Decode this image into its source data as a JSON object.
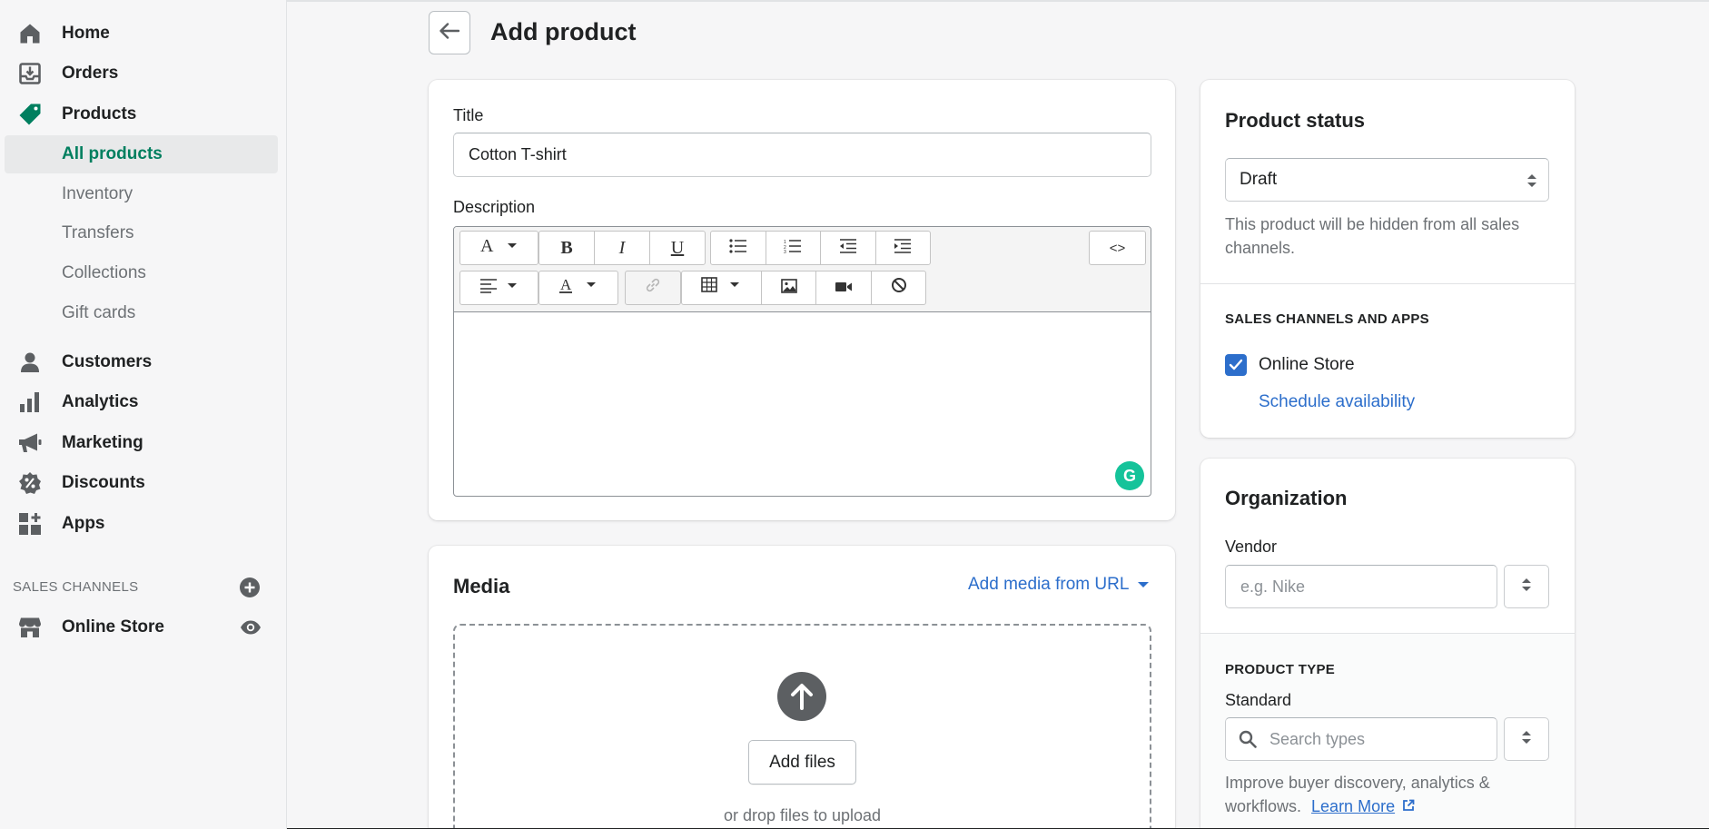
{
  "sidebar": {
    "items": [
      {
        "label": "Home",
        "icon": "home-icon"
      },
      {
        "label": "Orders",
        "icon": "orders-icon"
      },
      {
        "label": "Products",
        "icon": "tag-icon"
      },
      {
        "label": "Customers",
        "icon": "person-icon"
      },
      {
        "label": "Analytics",
        "icon": "bar-chart-icon"
      },
      {
        "label": "Marketing",
        "icon": "megaphone-icon"
      },
      {
        "label": "Discounts",
        "icon": "discount-icon"
      },
      {
        "label": "Apps",
        "icon": "apps-icon"
      }
    ],
    "products_sub": [
      {
        "label": "All products",
        "active": true
      },
      {
        "label": "Inventory"
      },
      {
        "label": "Transfers"
      },
      {
        "label": "Collections"
      },
      {
        "label": "Gift cards"
      }
    ],
    "sales_channels_label": "SALES CHANNELS",
    "sales_channels": [
      {
        "label": "Online Store",
        "icon": "store-icon"
      }
    ]
  },
  "header": {
    "title": "Add product"
  },
  "product_form": {
    "title_label": "Title",
    "title_value": "Cotton T-shirt",
    "description_label": "Description",
    "source_button": "<>"
  },
  "media": {
    "title": "Media",
    "add_from_url": "Add media from URL",
    "add_files": "Add files",
    "drop_text": "or drop files to upload"
  },
  "status_card": {
    "title": "Product status",
    "status_value": "Draft",
    "status_help": "This product will be hidden from all sales channels.",
    "channels_heading": "SALES CHANNELS AND APPS",
    "channel_name": "Online Store",
    "channel_checked": true,
    "schedule_link": "Schedule availability"
  },
  "organization_card": {
    "title": "Organization",
    "vendor_label": "Vendor",
    "vendor_placeholder": "e.g. Nike",
    "product_type_heading": "PRODUCT TYPE",
    "product_type_label": "Standard",
    "type_search_placeholder": "Search types",
    "type_help": "Improve buyer discovery, analytics &",
    "type_help_2": "workflows.",
    "learn_more": "Learn More"
  },
  "colors": {
    "accent_green": "#007f5f",
    "link_blue": "#2c6ecb",
    "grammarly_green": "#15c39a"
  }
}
